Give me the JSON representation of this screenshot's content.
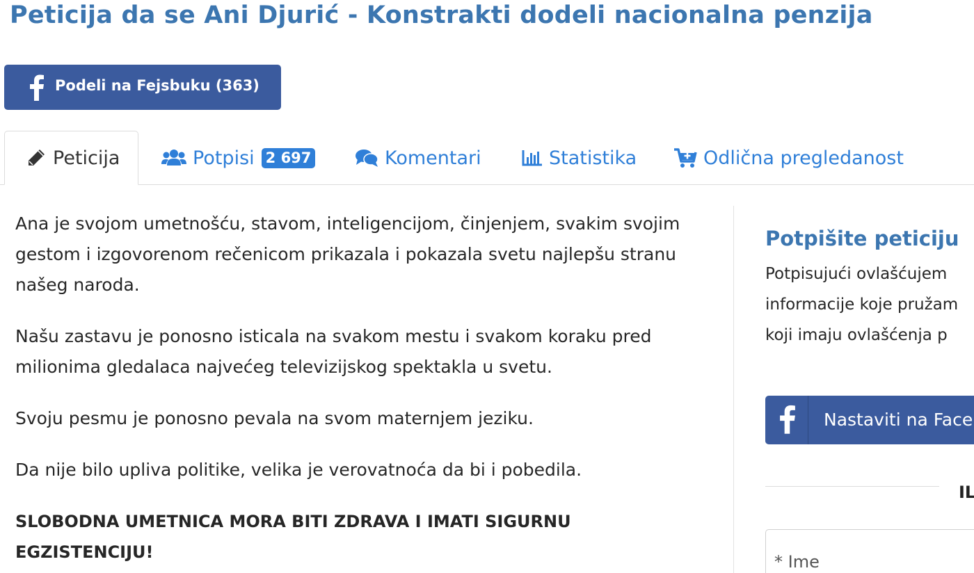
{
  "page": {
    "title": "Peticija da se Ani Djurić - Konstrakti dodeli nacionalna penzija"
  },
  "share": {
    "facebook_label": "Podeli na Fejsbuku (363)"
  },
  "tabs": [
    {
      "label": "Peticija",
      "icon": "pencil-icon",
      "active": true
    },
    {
      "label": "Potpisi",
      "icon": "users-icon",
      "badge": "2 697"
    },
    {
      "label": "Komentari",
      "icon": "comments-icon"
    },
    {
      "label": "Statistika",
      "icon": "bar-chart-icon"
    },
    {
      "label": "Odlična pregledanost",
      "icon": "cart-plus-icon"
    }
  ],
  "petition": {
    "paragraphs": [
      "Ana je svojom umetnošću, stavom, inteligencijom, činjenjem, svakim svojim gestom i izgovorenom rečenicom prikazala i pokazala svetu najlepšu stranu našeg naroda.",
      "Našu zastavu je ponosno isticala na svakom mestu i svakom koraku pred milionima gledalaca najvećeg televizijskog spektakla u svetu.",
      "Svoju pesmu je ponosno pevala na svom maternjem jeziku.",
      "Da nije bilo upliva politike, velika je verovatnoća da bi i pobedila."
    ],
    "emphasis": "SLOBODNA UMETNICA MORA BITI ZDRAVA I IMATI SIGURNU EGZISTENCIJU!"
  },
  "sidebar": {
    "heading": "Potpišite peticiju",
    "desc_lines": [
      "Potpisujući ovlašćujem",
      "informacije koje pružam",
      "koji imaju ovlašćenja p"
    ],
    "facebook_continue": "Nastaviti na Facebook",
    "or_text": "ILI",
    "name_placeholder": "* Ime"
  },
  "colors": {
    "title_blue": "#3c76b0",
    "link_blue": "#2f7fd8",
    "facebook_blue": "#3b5b9e"
  }
}
